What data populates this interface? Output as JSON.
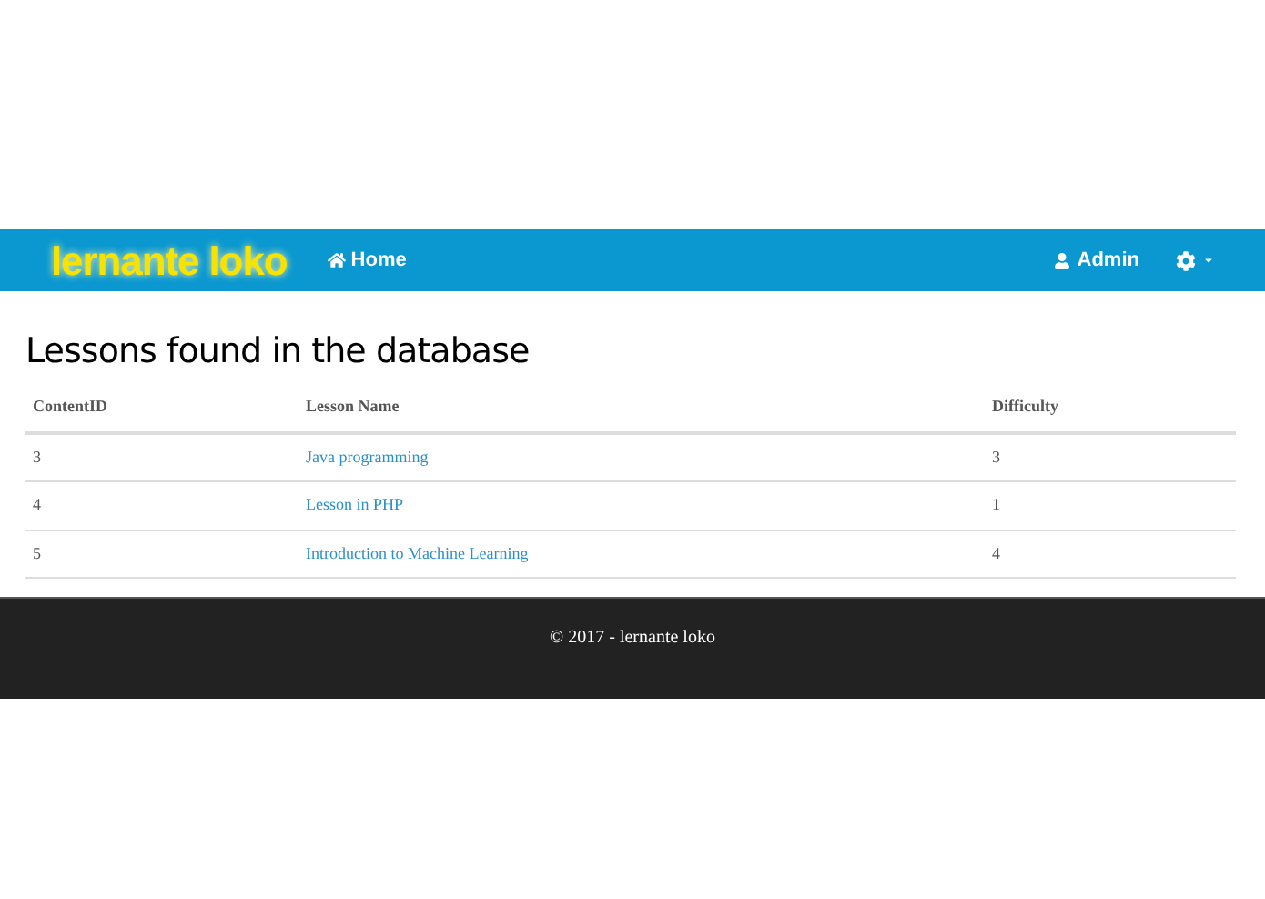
{
  "navbar": {
    "brand": "lernante loko",
    "links": [
      {
        "label": "Home",
        "kind": "home"
      }
    ],
    "right": [
      {
        "label": "Admin",
        "kind": "user"
      },
      {
        "kind": "settings"
      }
    ]
  },
  "heading": "Lessons found in the database",
  "table": {
    "columns": [
      "ContentID",
      "Lesson Name",
      "Difficulty"
    ],
    "rows": [
      [
        "3",
        "Java programming",
        "3"
      ],
      [
        "4",
        "Lesson in PHP",
        "1"
      ],
      [
        "5",
        "Introduction to Machine Learning",
        "4"
      ]
    ]
  },
  "footer": "© 2017 - lernante loko"
}
